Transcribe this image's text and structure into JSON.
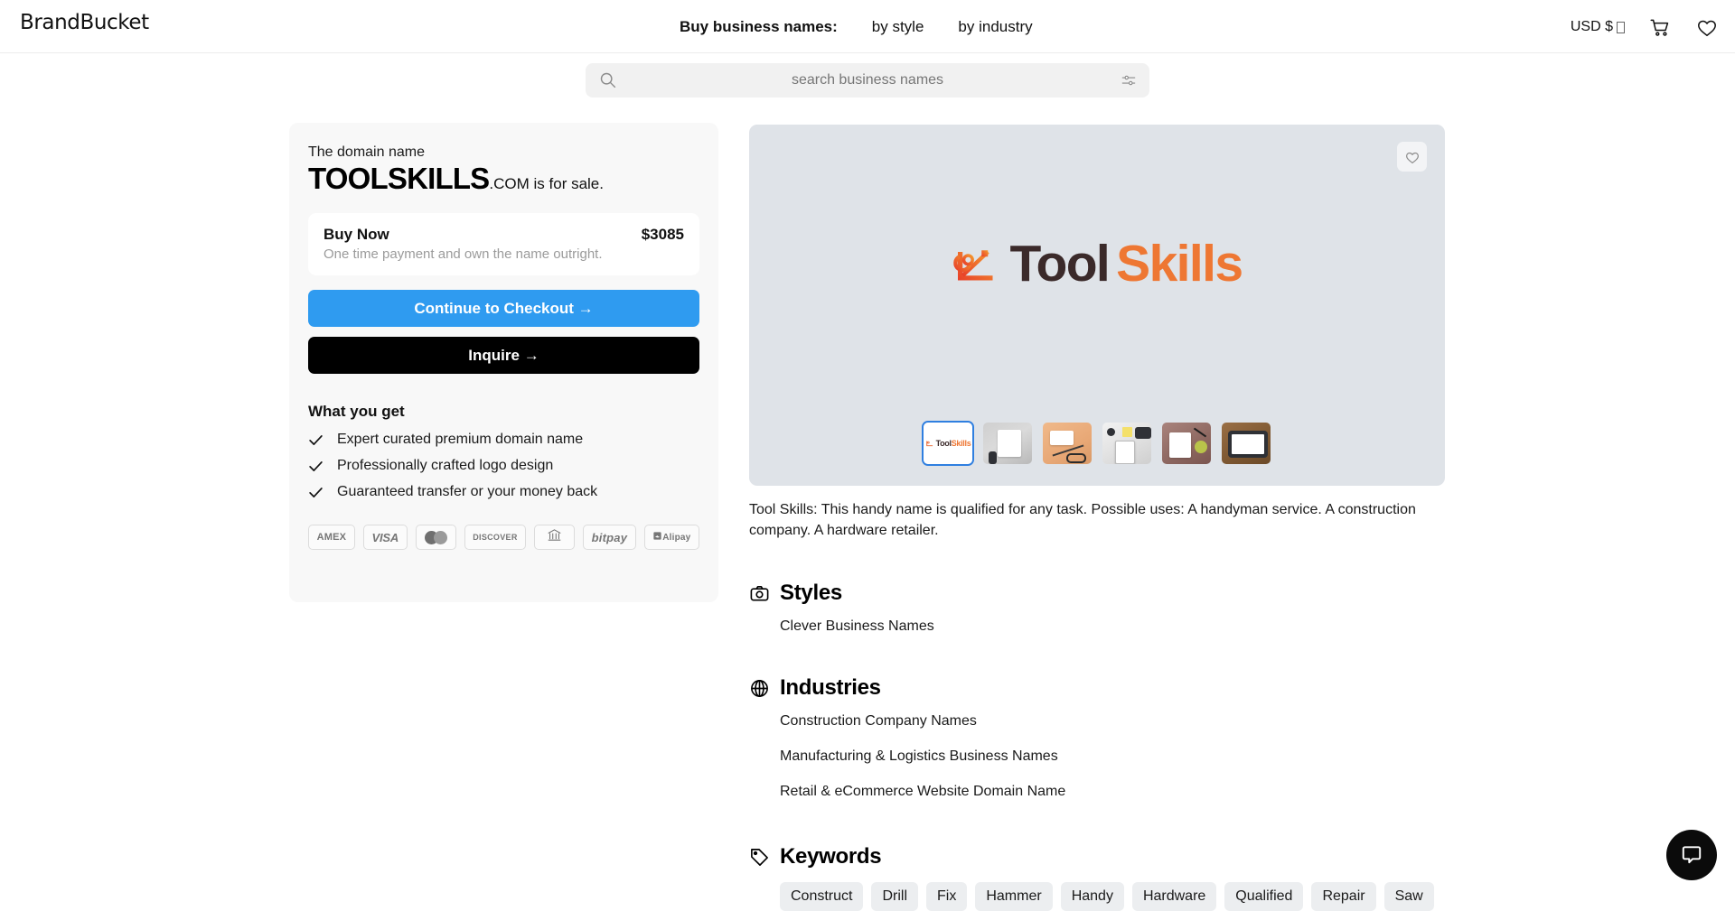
{
  "header": {
    "brand": "BrandBucket",
    "nav_lead": "Buy business names:",
    "nav_links": [
      {
        "label": "by style"
      },
      {
        "label": "by industry"
      }
    ],
    "currency": "USD $",
    "cart_icon": "cart-icon",
    "wishlist_icon": "heart-icon"
  },
  "search": {
    "placeholder": "search business names",
    "search_icon": "search-icon",
    "filter_icon": "filter-sliders-icon"
  },
  "offer": {
    "kicker": "The domain name",
    "domain_name": "TOOLSKILLS",
    "domain_tld": ".COM is for sale.",
    "buy_now_title": "Buy Now",
    "price": "$3085",
    "buy_now_sub": "One time payment and own the name outright.",
    "checkout_label": "Continue to Checkout →",
    "inquire_label": "Inquire →",
    "what_you_get_title": "What you get",
    "benefits": [
      "Expert curated premium domain name",
      "Professionally crafted logo design",
      "Guaranteed transfer or your money back"
    ],
    "payments": [
      {
        "name": "amex",
        "label": "AMEX"
      },
      {
        "name": "visa",
        "label": "VISA"
      },
      {
        "name": "mastercard",
        "label": ""
      },
      {
        "name": "discover",
        "label": "DISCOVER"
      },
      {
        "name": "bank-transfer",
        "label": ""
      },
      {
        "name": "bitpay",
        "label": "bitpay"
      },
      {
        "name": "alipay",
        "label": "Alipay"
      }
    ]
  },
  "hero": {
    "favorite_icon": "heart-icon",
    "logo_word_1": "Tool",
    "logo_word_2": "Skills",
    "logo_mark_icon": "wrench-tool-icon",
    "accent_color": "#ee7733",
    "dark_color": "#3b2a2a",
    "background_color": "#dfe3e8",
    "thumbnails": [
      {
        "name": "thumb-logo",
        "selected": true
      },
      {
        "name": "thumb-mockup-desk-gray",
        "selected": false
      },
      {
        "name": "thumb-mockup-card-tan",
        "selected": false
      },
      {
        "name": "thumb-mockup-notebook",
        "selected": false
      },
      {
        "name": "thumb-mockup-wood-desk",
        "selected": false
      },
      {
        "name": "thumb-mockup-tablet",
        "selected": false
      }
    ]
  },
  "description": "Tool Skills: This handy name is qualified for any task. Possible uses: A handyman service. A construction company. A hardware retailer.",
  "styles": {
    "title": "Styles",
    "icon": "camera-icon",
    "items": [
      "Clever Business Names"
    ]
  },
  "industries": {
    "title": "Industries",
    "icon": "globe-icon",
    "items": [
      "Construction Company Names",
      "Manufacturing & Logistics Business Names",
      "Retail & eCommerce Website Domain Name"
    ]
  },
  "keywords": {
    "title": "Keywords",
    "icon": "tag-icon",
    "items": [
      "Construct",
      "Drill",
      "Fix",
      "Hammer",
      "Handy",
      "Hardware",
      "Qualified",
      "Repair",
      "Saw"
    ]
  },
  "chat": {
    "icon": "chat-bubble-icon"
  }
}
